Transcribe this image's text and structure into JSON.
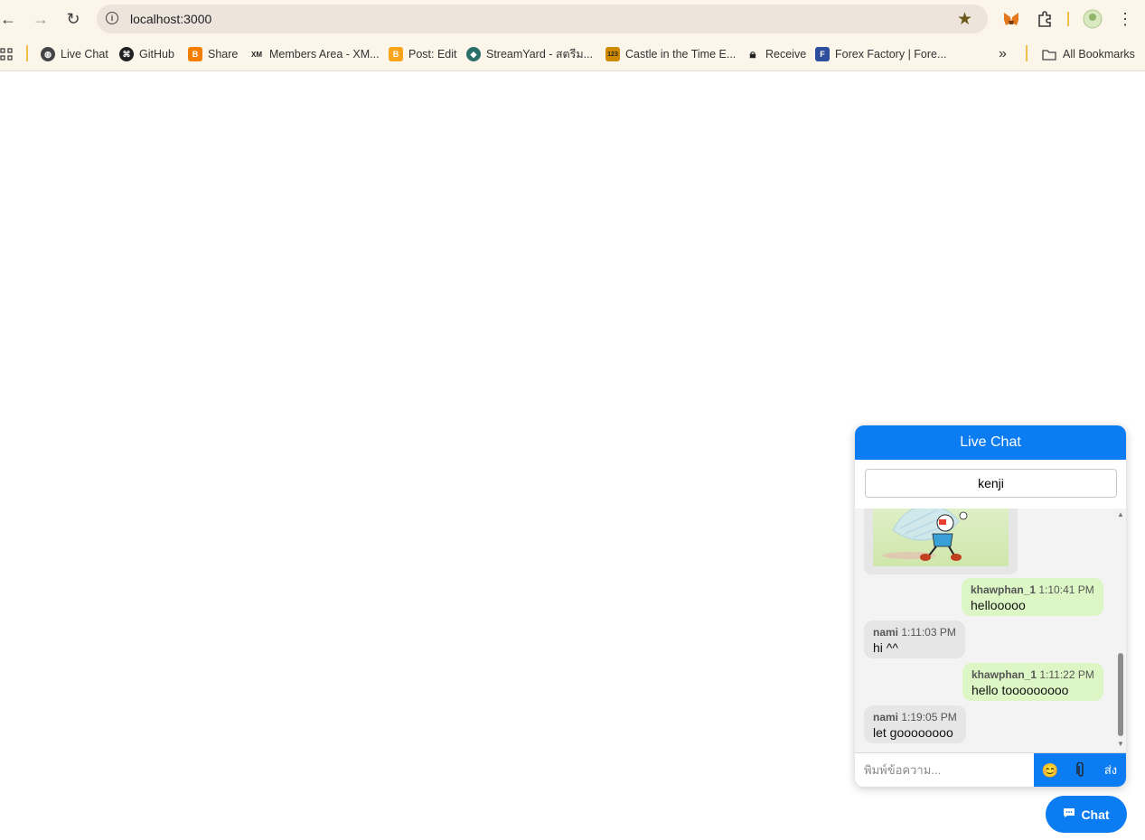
{
  "browser": {
    "url": "localhost:3000",
    "bookmarks": [
      {
        "label": "Live Chat",
        "icon": "globe-icon"
      },
      {
        "label": "GitHub",
        "icon": "github-icon"
      },
      {
        "label": "Share",
        "icon": "blogger-icon"
      },
      {
        "label": "Members Area - XM...",
        "icon": "xm-icon"
      },
      {
        "label": "Post: Edit",
        "icon": "blogger-icon"
      },
      {
        "label": "StreamYard - สตรีม...",
        "icon": "streamyard-icon"
      },
      {
        "label": "Castle in the Time E...",
        "icon": "123hd-icon"
      },
      {
        "label": "Receive",
        "icon": "lock-icon"
      },
      {
        "label": "Forex Factory | Fore...",
        "icon": "forexfactory-icon"
      }
    ],
    "all_bookmarks_label": "All Bookmarks"
  },
  "chat": {
    "header_title": "Live Chat",
    "username_value": "kenji",
    "messages": [
      {
        "user": "khawphan_1",
        "time": "1:10:41 PM",
        "text": "hellooooo",
        "self": true
      },
      {
        "user": "nami",
        "time": "1:11:03 PM",
        "text": "hi ^^",
        "self": false
      },
      {
        "user": "khawphan_1",
        "time": "1:11:22 PM",
        "text": "hello tooooooooo",
        "self": true
      },
      {
        "user": "nami",
        "time": "1:19:05 PM",
        "text": "let goooooooo",
        "self": false
      }
    ],
    "input_placeholder": "พิมพ์ข้อความ...",
    "send_label": "ส่ง",
    "emoji_icon": "😊",
    "attach_icon": "paperclip-icon"
  },
  "chat_toggle_label": "Chat",
  "colors": {
    "accent": "#0b7cf2",
    "self_bubble": "#dcf7c5",
    "other_bubble": "#e6e6e6"
  }
}
